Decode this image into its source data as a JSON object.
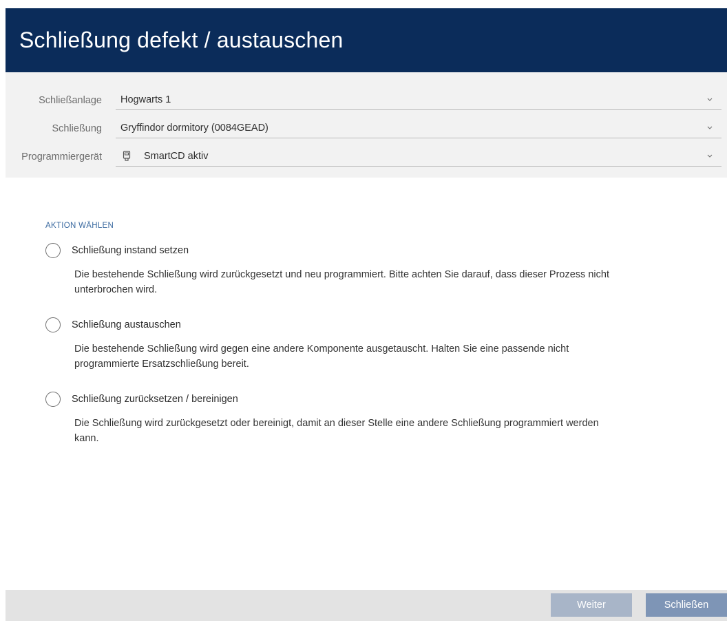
{
  "window": {
    "title": "Schließung defekt / austauschen"
  },
  "form": {
    "fields": [
      {
        "label": "Schließanlage",
        "value": "Hogwarts 1"
      },
      {
        "label": "Schließung",
        "value": "Gryffindor dormitory (0084GEAD)"
      },
      {
        "label": "Programmiergerät",
        "value": "SmartCD aktiv",
        "icon": "smartcd-device-icon"
      }
    ]
  },
  "actions": {
    "heading": "AKTION WÄHLEN",
    "options": [
      {
        "label": "Schließung instand setzen",
        "description": "Die bestehende Schließung wird zurückgesetzt und neu programmiert. Bitte achten Sie darauf, dass dieser Prozess nicht unterbrochen wird.",
        "selected": false
      },
      {
        "label": "Schließung austauschen",
        "description": "Die bestehende Schließung wird gegen eine andere Komponente ausgetauscht. Halten Sie eine passende nicht programmierte Ersatzschließung bereit.",
        "selected": false
      },
      {
        "label": "Schließung zurücksetzen / bereinigen",
        "description": "Die Schließung wird zurückgesetzt oder bereinigt, damit an dieser Stelle eine andere Schließung programmiert werden kann.",
        "selected": false
      }
    ]
  },
  "footer": {
    "next_label": "Weiter",
    "close_label": "Schließen"
  },
  "colors": {
    "title_bar": "#0b2c5a",
    "heading_accent": "#3b6aa0",
    "button_disabled": "#a8b5c8",
    "button_primary": "#7e95b6"
  }
}
